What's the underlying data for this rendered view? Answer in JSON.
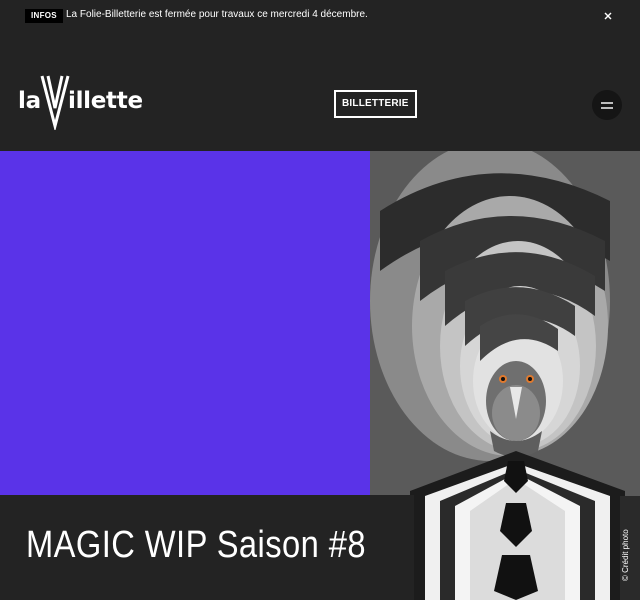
{
  "info_bar": {
    "badge": "INFOS",
    "message": "La Folie-Billetterie est fermée pour travaux ce mercredi 4 décembre.",
    "close_icon": "close-icon"
  },
  "header": {
    "logo_left": "la",
    "logo_right": "illette",
    "billetterie_label": "BILLETTERIE",
    "menu_icon": "hamburger-menu-icon"
  },
  "hero": {
    "title": "MAGIC WIP Saison #8",
    "photo_credit": "© Crédit photo"
  },
  "colors": {
    "background": "#232323",
    "hero_accent": "#5a33e8",
    "text": "#ffffff"
  }
}
